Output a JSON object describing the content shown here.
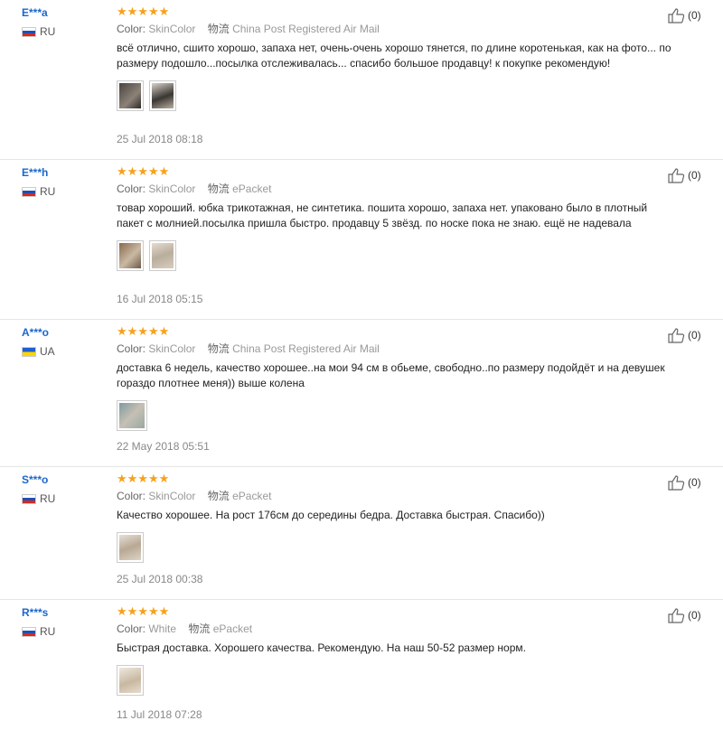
{
  "labels": {
    "color": "Color:",
    "shipping": "物流"
  },
  "reviews": [
    {
      "user": "E***a",
      "country": "RU",
      "flag": "ru",
      "stars": "★★★★★",
      "color": "SkinColor",
      "shipping": "China Post Registered Air Mail",
      "text": "всё отлично, сшито хорошо, запаха нет, очень-очень хорошо тянется, по длине коротенькая, как на фото... по размеру подошло...посылка отслеживалась... спасибо большое продавцу! к покупке рекомендую!",
      "photos": [
        "photo-1",
        "photo-2"
      ],
      "date": "25 Jul 2018 08:18",
      "helpful": "(0)"
    },
    {
      "user": "E***h",
      "country": "RU",
      "flag": "ru",
      "stars": "★★★★★",
      "color": "SkinColor",
      "shipping": "ePacket",
      "text": "товар хороший. юбка трикотажная, не синтетика. пошита хорошо, запаха нет. упаковано было в плотный пакет с молнией.посылка пришла быстро. продавцу 5 звёзд. по носке пока не знаю. ещё не надевала",
      "photos": [
        "photo-1",
        "photo-2"
      ],
      "date": "16 Jul 2018 05:15",
      "helpful": "(0)"
    },
    {
      "user": "A***o",
      "country": "UA",
      "flag": "ua",
      "stars": "★★★★★",
      "color": "SkinColor",
      "shipping": "China Post Registered Air Mail",
      "text": "доставка 6 недель, качество хорошее..на мои 94 см в обьеме, свободно..по размеру подойдёт и на девушек гораздо плотнее меня)) выше колена",
      "photos": [
        "photo-1"
      ],
      "date": "22 May 2018 05:51",
      "helpful": "(0)"
    },
    {
      "user": "S***o",
      "country": "RU",
      "flag": "ru",
      "stars": "★★★★★",
      "color": "SkinColor",
      "shipping": "ePacket",
      "text": "Качество хорошее. На рост 176см до середины бедра. Доставка быстрая. Спасибо))",
      "photos": [
        "photo-1"
      ],
      "date": "25 Jul 2018 00:38",
      "helpful": "(0)"
    },
    {
      "user": "R***s",
      "country": "RU",
      "flag": "ru",
      "stars": "★★★★★",
      "color": "White",
      "shipping": "ePacket",
      "text": "Быстрая доставка. Хорошего качества. Рекомендую. На наш 50-52 размер норм.",
      "photos": [
        "photo-1"
      ],
      "date": "11 Jul 2018 07:28",
      "helpful": "(0)"
    }
  ]
}
